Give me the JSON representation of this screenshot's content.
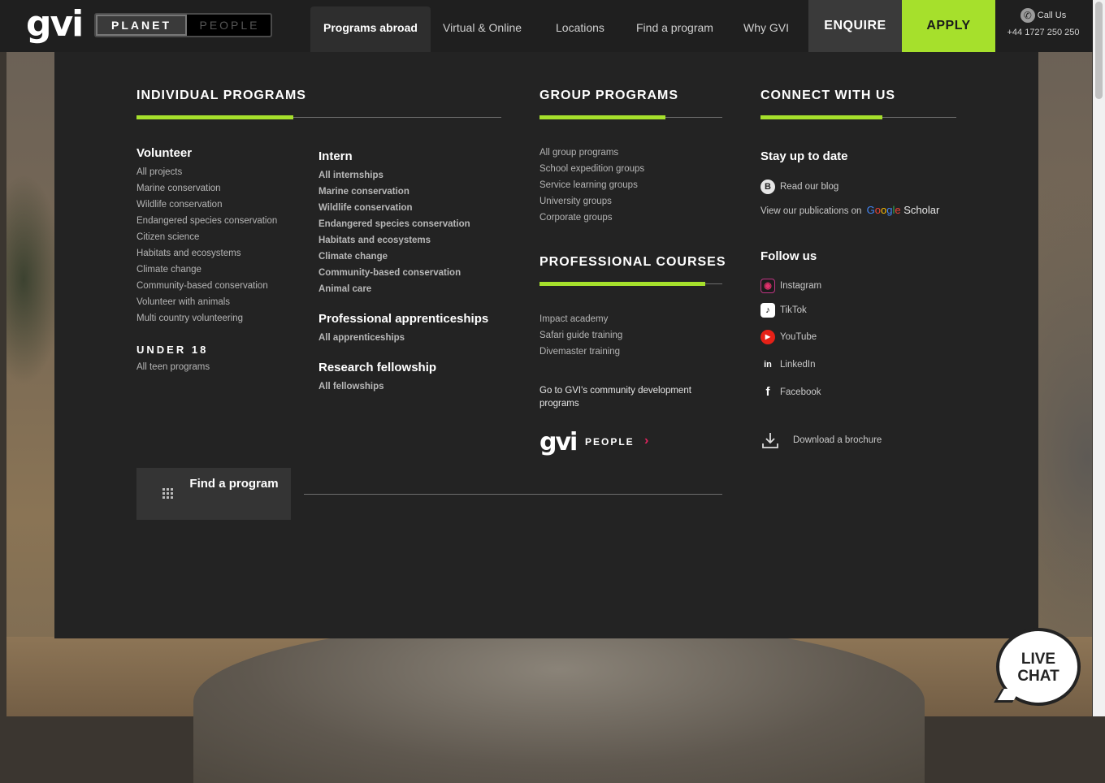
{
  "brand": {
    "logo": "gvi"
  },
  "toggle": {
    "planet": "PLANET",
    "people": "PEOPLE"
  },
  "nav": {
    "items": [
      "Programs abroad",
      "Virtual & Online",
      "Locations",
      "Find a program",
      "Why GVI"
    ],
    "enquire": "ENQUIRE",
    "apply": "APPLY",
    "call_label": "Call Us",
    "phone": "+44 1727 250 250"
  },
  "individual": {
    "title": "INDIVIDUAL PROGRAMS",
    "volunteer": {
      "heading": "Volunteer",
      "items": [
        "All projects",
        "Marine conservation",
        "Wildlife conservation",
        "Endangered species conservation",
        "Citizen science",
        "Habitats and ecosystems",
        "Climate change",
        "Community-based conservation",
        "Volunteer with animals",
        "Multi country volunteering"
      ]
    },
    "under18": {
      "heading": "UNDER 18",
      "items": [
        "All teen programs"
      ]
    },
    "intern": {
      "heading": "Intern",
      "items": [
        "All internships",
        "Marine conservation",
        "Wildlife conservation",
        "Endangered species conservation",
        "Habitats and ecosystems",
        "Climate change",
        "Community-based conservation",
        "Animal care"
      ]
    },
    "apprentice": {
      "heading": "Professional apprenticeships",
      "items": [
        "All apprenticeships"
      ]
    },
    "research": {
      "heading": "Research fellowship",
      "items": [
        "All fellowships"
      ]
    },
    "find_button": "Find a program"
  },
  "group": {
    "title": "GROUP PROGRAMS",
    "items": [
      "All group programs",
      "School expedition groups",
      "Service learning groups",
      "University groups",
      "Corporate groups"
    ]
  },
  "professional": {
    "title": "PROFESSIONAL COURSES",
    "items": [
      "Impact academy",
      "Safari guide training",
      "Divemaster training"
    ],
    "community_text": "Go to GVI's community development programs",
    "people_logo": "gvi",
    "people_word": "PEOPLE"
  },
  "connect": {
    "title": "CONNECT WITH US",
    "stay_heading": "Stay up to date",
    "blog": "Read our blog",
    "publications": "View our publications on",
    "scholar": "Google Scholar",
    "follow_heading": "Follow us",
    "socials": [
      "Instagram",
      "TikTok",
      "YouTube",
      "LinkedIn",
      "Facebook"
    ],
    "brochure": "Download a brochure"
  },
  "live_chat": {
    "line1": "LIVE",
    "line2": "CHAT"
  },
  "colors": {
    "accent": "#a6e02c",
    "menu_bg": "#232323",
    "topbar_bg": "#1f1f1f",
    "people_arrow": "#e0245e"
  }
}
